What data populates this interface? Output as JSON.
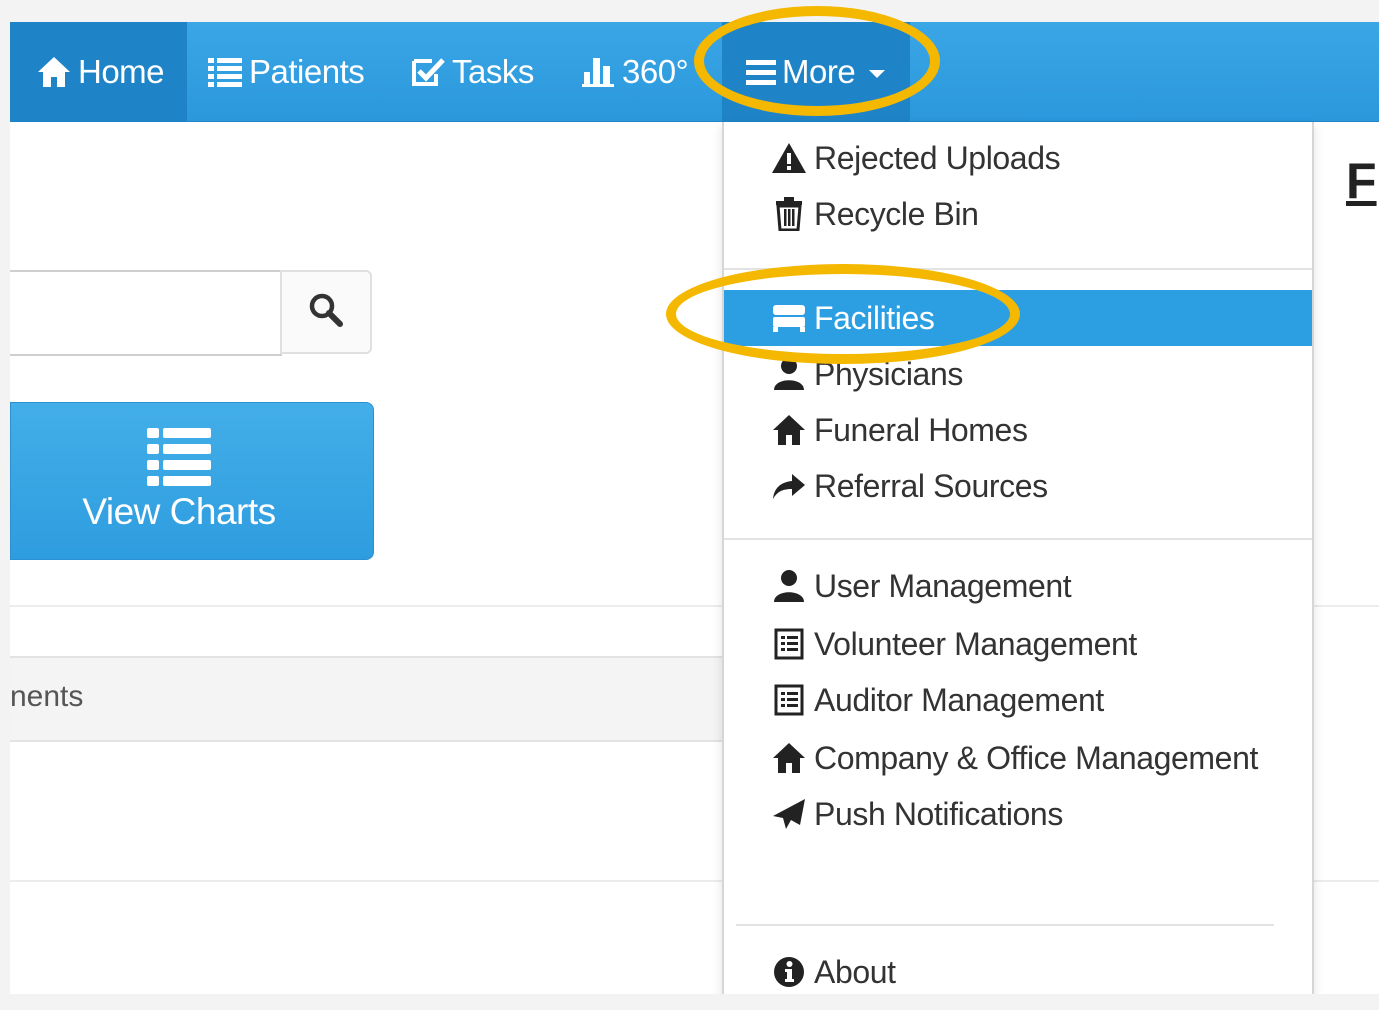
{
  "navbar": {
    "items": [
      {
        "label": "Home",
        "icon": "home-icon"
      },
      {
        "label": "Patients",
        "icon": "list-icon"
      },
      {
        "label": "Tasks",
        "icon": "check-square-icon"
      },
      {
        "label": "360°",
        "icon": "bar-chart-icon"
      },
      {
        "label": "More",
        "icon": "menu-icon"
      }
    ]
  },
  "main": {
    "search": {
      "placeholder": "",
      "icon": "search-icon"
    },
    "view_charts_label": "View Charts",
    "gray_row_text": "nents",
    "right_title": "F"
  },
  "dropdown": {
    "items": [
      {
        "label": "Rejected Uploads",
        "icon": "warning-icon"
      },
      {
        "label": "Recycle Bin",
        "icon": "trash-icon"
      },
      {
        "label": "Facilities",
        "icon": "bed-icon",
        "active": true
      },
      {
        "label": "Physicians",
        "icon": "user-icon"
      },
      {
        "label": "Funeral Homes",
        "icon": "home-icon"
      },
      {
        "label": "Referral Sources",
        "icon": "share-arrow-icon"
      },
      {
        "label": "User Management",
        "icon": "user-icon"
      },
      {
        "label": "Volunteer Management",
        "icon": "list-alt-icon"
      },
      {
        "label": "Auditor Management",
        "icon": "list-alt-icon"
      },
      {
        "label": "Company & Office Management",
        "icon": "home-icon"
      },
      {
        "label": "Push Notifications",
        "icon": "send-icon"
      },
      {
        "label": "About",
        "icon": "info-icon"
      }
    ]
  },
  "colors": {
    "navbar": "#2b98dc",
    "nav_active": "#1f84c7",
    "active_item": "#2c9fe3",
    "highlight_ring": "#f5b800"
  }
}
